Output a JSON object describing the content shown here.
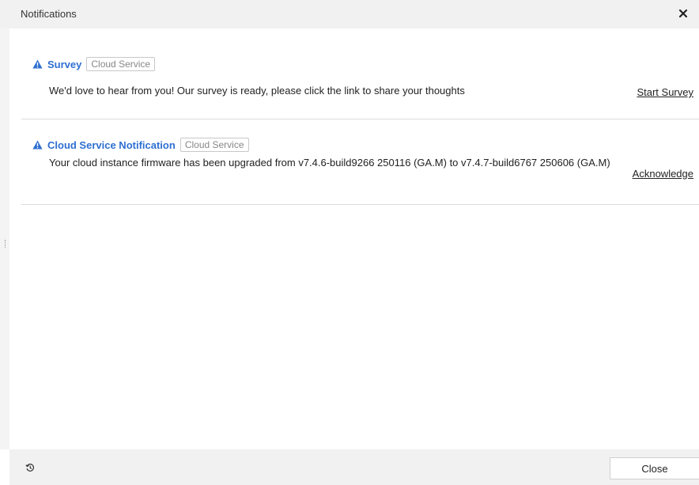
{
  "window": {
    "title": "Notifications"
  },
  "notifications": [
    {
      "title": "Survey",
      "tag": "Cloud Service",
      "message": "We'd love to hear from you! Our survey is ready, please click the link to share your thoughts",
      "action": "Start Survey",
      "icon": "warning-icon"
    },
    {
      "title": "Cloud Service Notification",
      "tag": "Cloud Service",
      "message": "Your cloud instance firmware has been upgraded from v7.4.6-build9266 250116 (GA.M) to v7.4.7-build6767 250606 (GA.M)",
      "action": "Acknowledge",
      "icon": "warning-icon"
    }
  ],
  "footer": {
    "close_label": "Close",
    "history_icon": "history-icon"
  },
  "colors": {
    "title_blue": "#2f6fd1",
    "header_bg": "#f1f1f1"
  }
}
